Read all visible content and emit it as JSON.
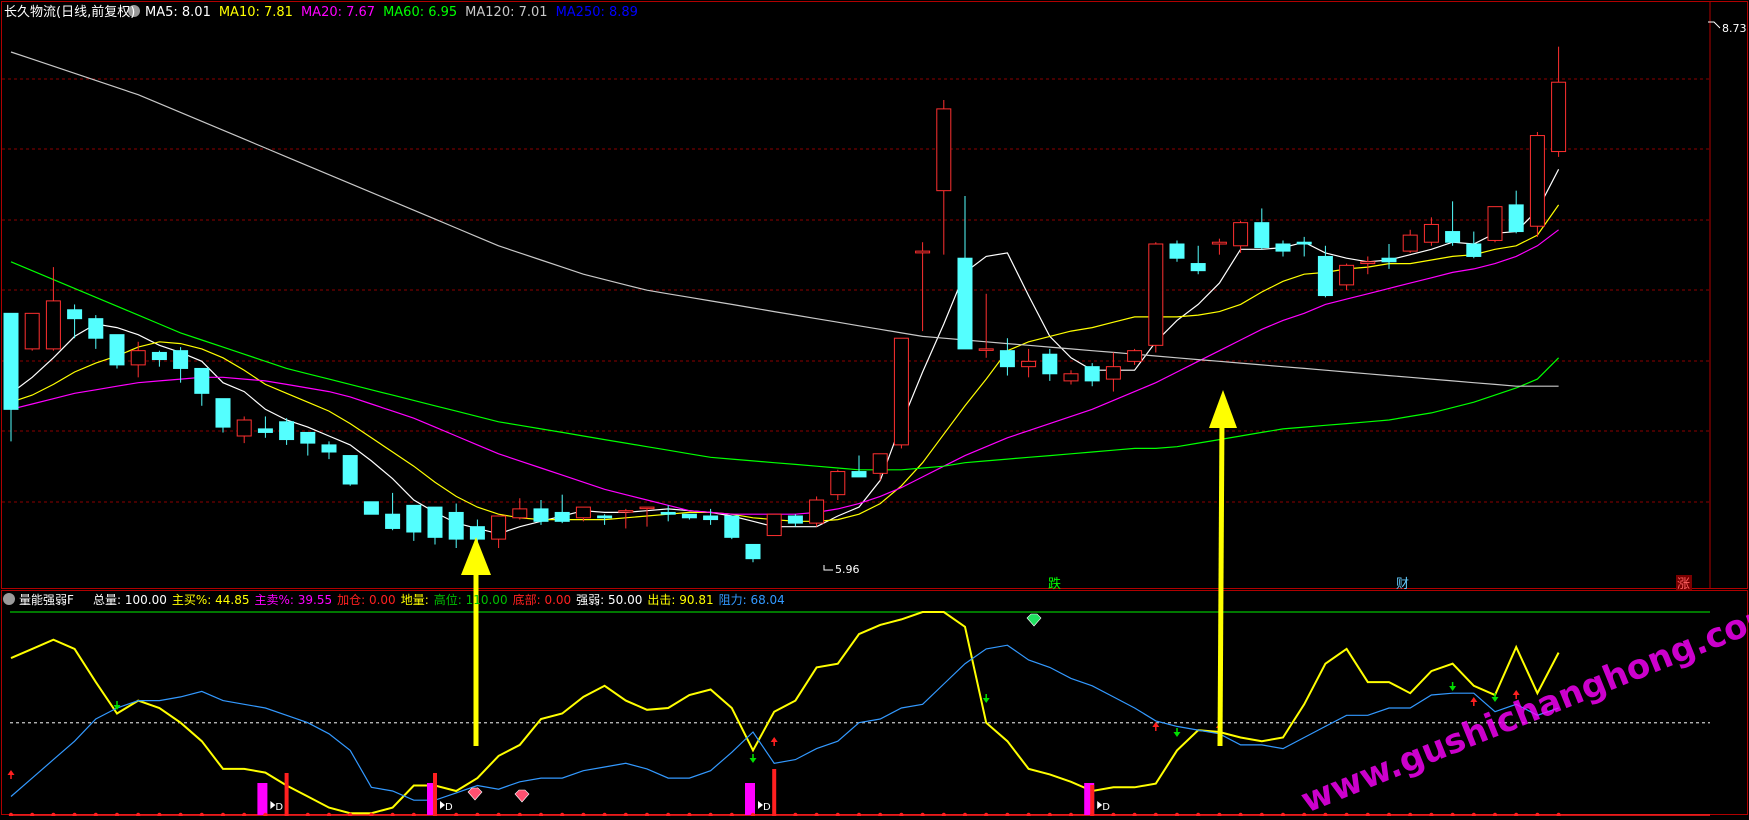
{
  "header": {
    "title": "长久物流(日线,前复权)",
    "ma": [
      {
        "label": "MA5: 8.01",
        "color": "#FFFFFF"
      },
      {
        "label": "MA10: 7.81",
        "color": "#FFFF00"
      },
      {
        "label": "MA20: 7.67",
        "color": "#FF00FF"
      },
      {
        "label": "MA60: 6.95",
        "color": "#00FF00"
      },
      {
        "label": "MA120: 7.01",
        "color": "#C8C8C8"
      },
      {
        "label": "MA250: 8.89",
        "color": "#0000FF"
      }
    ]
  },
  "indicator_header": {
    "name": "量能强弱F",
    "items": [
      {
        "label": "总量: 100.00",
        "color": "#FFFFFF"
      },
      {
        "label": "主买%: 44.85",
        "color": "#FFFF00"
      },
      {
        "label": "主卖%: 39.55",
        "color": "#FF00FF"
      },
      {
        "label": "加仓: 0.00",
        "color": "#FF2020"
      },
      {
        "label": "地量:",
        "color": "#FFFF00"
      },
      {
        "label": "高位: 110.00",
        "color": "#00C000"
      },
      {
        "label": "底部: 0.00",
        "color": "#FF2020"
      },
      {
        "label": "强弱: 50.00",
        "color": "#FFFFFF"
      },
      {
        "label": "出击: 90.81",
        "color": "#FFFF00"
      },
      {
        "label": "阻力: 68.04",
        "color": "#3399FF"
      }
    ]
  },
  "price_labels": {
    "high": "8.73",
    "low": "5.96"
  },
  "event_labels": [
    {
      "text": "跌",
      "color": "#00FF00"
    },
    {
      "text": "财",
      "color": "#66CCFF"
    },
    {
      "text": "涨",
      "color": "#FF4040"
    }
  ],
  "watermark": "www.gushichanghong.com",
  "colors": {
    "up": "#FF3030",
    "down": "#54FFFF",
    "grid": "#8B0000",
    "arrow": "#FFFF00"
  },
  "chart_data": [
    {
      "type": "candlestick",
      "ylim": [
        5.7,
        8.85
      ],
      "candles": [
        [
          7.2,
          6.66,
          7.2,
          6.48
        ],
        [
          7.0,
          7.2,
          7.2,
          6.99
        ],
        [
          7.0,
          7.27,
          7.46,
          6.99
        ],
        [
          7.22,
          7.17,
          7.25,
          7.06
        ],
        [
          7.17,
          7.06,
          7.19,
          7.0
        ],
        [
          7.08,
          6.91,
          7.08,
          6.89
        ],
        [
          6.91,
          6.99,
          7.04,
          6.84
        ],
        [
          6.98,
          6.94,
          6.99,
          6.9
        ],
        [
          6.99,
          6.89,
          7.01,
          6.81
        ],
        [
          6.89,
          6.75,
          6.89,
          6.68
        ],
        [
          6.72,
          6.56,
          6.72,
          6.53
        ],
        [
          6.51,
          6.6,
          6.62,
          6.47
        ],
        [
          6.55,
          6.53,
          6.62,
          6.5
        ],
        [
          6.59,
          6.49,
          6.61,
          6.46
        ],
        [
          6.53,
          6.47,
          6.53,
          6.4
        ],
        [
          6.46,
          6.42,
          6.48,
          6.38
        ],
        [
          6.4,
          6.24,
          6.4,
          6.23
        ],
        [
          6.14,
          6.07,
          6.14,
          6.07
        ],
        [
          6.07,
          5.99,
          6.19,
          5.98
        ],
        [
          6.12,
          5.97,
          6.09,
          5.92
        ],
        [
          6.11,
          5.94,
          6.11,
          5.9
        ],
        [
          6.08,
          5.93,
          6.13,
          5.88
        ],
        [
          6.0,
          5.93,
          6.04,
          5.87
        ],
        [
          5.93,
          6.06,
          6.06,
          5.88
        ],
        [
          6.05,
          6.1,
          6.16,
          6.04
        ],
        [
          6.1,
          6.03,
          6.15,
          6.01
        ],
        [
          6.08,
          6.03,
          6.18,
          6.02
        ],
        [
          6.05,
          6.11,
          6.11,
          6.03
        ],
        [
          6.06,
          6.05,
          6.07,
          6.01
        ],
        [
          6.09,
          6.09,
          6.1,
          5.99
        ],
        [
          6.11,
          6.11,
          6.11,
          6.0
        ],
        [
          6.08,
          6.07,
          6.12,
          6.03
        ],
        [
          6.07,
          6.05,
          6.07,
          6.04
        ],
        [
          6.06,
          6.04,
          6.1,
          6.01
        ],
        [
          6.06,
          5.94,
          6.06,
          5.93
        ],
        [
          5.9,
          5.82,
          5.9,
          5.8
        ],
        [
          5.95,
          6.07,
          6.07,
          5.95
        ],
        [
          6.06,
          6.02,
          6.07,
          6.0
        ],
        [
          6.02,
          6.15,
          6.17,
          6.0
        ],
        [
          6.18,
          6.31,
          6.32,
          6.15
        ],
        [
          6.31,
          6.28,
          6.4,
          6.28
        ],
        [
          6.3,
          6.41,
          6.41,
          6.26
        ],
        [
          6.46,
          7.06,
          7.06,
          6.44
        ],
        [
          7.54,
          7.55,
          7.6,
          7.1
        ],
        [
          7.89,
          8.35,
          8.4,
          7.53
        ],
        [
          7.51,
          7.0,
          7.86,
          7.0
        ],
        [
          7.0,
          7.0,
          7.31,
          6.95
        ],
        [
          6.99,
          6.9,
          7.06,
          6.85
        ],
        [
          6.9,
          6.93,
          7.0,
          6.84
        ],
        [
          6.97,
          6.86,
          7.0,
          6.82
        ],
        [
          6.82,
          6.86,
          6.88,
          6.8
        ],
        [
          6.9,
          6.82,
          6.92,
          6.79
        ],
        [
          6.83,
          6.9,
          6.98,
          6.76
        ],
        [
          6.93,
          6.99,
          7.0,
          6.91
        ],
        [
          7.02,
          7.59,
          7.6,
          6.98
        ],
        [
          7.59,
          7.51,
          7.61,
          7.49
        ],
        [
          7.48,
          7.44,
          7.58,
          7.42
        ],
        [
          7.59,
          7.6,
          7.62,
          7.53
        ],
        [
          7.58,
          7.71,
          7.72,
          7.54
        ],
        [
          7.71,
          7.57,
          7.79,
          7.56
        ],
        [
          7.59,
          7.55,
          7.61,
          7.52
        ],
        [
          7.6,
          7.59,
          7.63,
          7.52
        ],
        [
          7.52,
          7.3,
          7.58,
          7.29
        ],
        [
          7.36,
          7.47,
          7.48,
          7.33
        ],
        [
          7.48,
          7.49,
          7.52,
          7.42
        ],
        [
          7.51,
          7.49,
          7.59,
          7.45
        ],
        [
          7.55,
          7.64,
          7.67,
          7.54
        ],
        [
          7.6,
          7.7,
          7.74,
          7.58
        ],
        [
          7.66,
          7.6,
          7.83,
          7.58
        ],
        [
          7.59,
          7.52,
          7.66,
          7.51
        ],
        [
          7.61,
          7.8,
          7.8,
          7.6
        ],
        [
          7.81,
          7.66,
          7.89,
          7.65
        ],
        [
          7.69,
          8.2,
          8.22,
          7.63
        ],
        [
          8.11,
          8.5,
          8.7,
          8.08
        ]
      ],
      "ma": [
        {
          "name": "MA5",
          "color": "#FFFFFF",
          "values": [
            6.75,
            6.84,
            6.95,
            7.07,
            7.14,
            7.12,
            7.08,
            7.02,
            6.98,
            6.93,
            6.81,
            6.76,
            6.66,
            6.6,
            6.56,
            6.51,
            6.46,
            6.37,
            6.27,
            6.15,
            6.08,
            6.02,
            5.99,
            5.96,
            6.0,
            6.03,
            6.06,
            6.09,
            6.08,
            6.08,
            6.09,
            6.1,
            6.09,
            6.08,
            6.06,
            6.03,
            6.0,
            6.0,
            6.0,
            6.06,
            6.11,
            6.26,
            6.58,
            6.87,
            7.14,
            7.43,
            7.52,
            7.54,
            7.3,
            7.07,
            6.95,
            6.88,
            6.88,
            6.88,
            7.04,
            7.16,
            7.25,
            7.37,
            7.56,
            7.56,
            7.57,
            7.6,
            7.54,
            7.51,
            7.49,
            7.5,
            7.53,
            7.56,
            7.6,
            7.59,
            7.65,
            7.66,
            7.78,
            8.01
          ]
        },
        {
          "name": "MA10",
          "color": "#FFFF00",
          "values": [
            6.7,
            6.74,
            6.8,
            6.87,
            6.92,
            6.96,
            7.01,
            7.04,
            7.03,
            7.0,
            6.95,
            6.88,
            6.8,
            6.75,
            6.7,
            6.65,
            6.58,
            6.5,
            6.42,
            6.34,
            6.25,
            6.17,
            6.11,
            6.07,
            6.05,
            6.04,
            6.04,
            6.04,
            6.04,
            6.05,
            6.06,
            6.07,
            6.08,
            6.08,
            6.07,
            6.05,
            6.04,
            6.03,
            6.03,
            6.04,
            6.07,
            6.13,
            6.23,
            6.36,
            6.52,
            6.68,
            6.83,
            6.99,
            7.04,
            7.07,
            7.1,
            7.12,
            7.15,
            7.18,
            7.18,
            7.18,
            7.19,
            7.21,
            7.25,
            7.32,
            7.38,
            7.42,
            7.43,
            7.45,
            7.46,
            7.48,
            7.48,
            7.5,
            7.52,
            7.53,
            7.56,
            7.58,
            7.64,
            7.81
          ]
        },
        {
          "name": "MA20",
          "color": "#FF00FF",
          "values": [
            6.66,
            6.69,
            6.72,
            6.75,
            6.77,
            6.79,
            6.81,
            6.82,
            6.83,
            6.84,
            6.84,
            6.83,
            6.82,
            6.8,
            6.78,
            6.76,
            6.73,
            6.69,
            6.65,
            6.61,
            6.56,
            6.51,
            6.46,
            6.41,
            6.37,
            6.33,
            6.29,
            6.25,
            6.21,
            6.18,
            6.15,
            6.12,
            6.09,
            6.08,
            6.07,
            6.07,
            6.07,
            6.07,
            6.08,
            6.1,
            6.13,
            6.17,
            6.22,
            6.28,
            6.34,
            6.4,
            6.45,
            6.5,
            6.54,
            6.58,
            6.62,
            6.66,
            6.71,
            6.76,
            6.81,
            6.87,
            6.93,
            6.99,
            7.05,
            7.11,
            7.16,
            7.2,
            7.25,
            7.28,
            7.31,
            7.34,
            7.37,
            7.4,
            7.43,
            7.45,
            7.48,
            7.52,
            7.58,
            7.67
          ]
        },
        {
          "name": "MA60",
          "color": "#00FF00",
          "values": [
            7.49,
            7.44,
            7.39,
            7.34,
            7.29,
            7.24,
            7.19,
            7.14,
            7.09,
            7.05,
            7.01,
            6.97,
            6.93,
            6.89,
            6.86,
            6.83,
            6.8,
            6.77,
            6.74,
            6.71,
            6.68,
            6.65,
            6.62,
            6.59,
            6.57,
            6.55,
            6.53,
            6.51,
            6.49,
            6.47,
            6.45,
            6.43,
            6.41,
            6.39,
            6.38,
            6.37,
            6.36,
            6.35,
            6.34,
            6.33,
            6.32,
            6.32,
            6.32,
            6.33,
            6.34,
            6.36,
            6.37,
            6.38,
            6.39,
            6.4,
            6.41,
            6.42,
            6.43,
            6.44,
            6.44,
            6.45,
            6.47,
            6.49,
            6.51,
            6.53,
            6.55,
            6.56,
            6.57,
            6.58,
            6.59,
            6.6,
            6.62,
            6.64,
            6.67,
            6.7,
            6.74,
            6.78,
            6.83,
            6.95
          ]
        },
        {
          "name": "MA120",
          "color": "#C8C8C8",
          "values": [
            8.67,
            8.63,
            8.59,
            8.55,
            8.51,
            8.47,
            8.43,
            8.38,
            8.33,
            8.28,
            8.23,
            8.18,
            8.13,
            8.08,
            8.03,
            7.98,
            7.93,
            7.88,
            7.83,
            7.78,
            7.73,
            7.68,
            7.63,
            7.58,
            7.54,
            7.5,
            7.46,
            7.42,
            7.39,
            7.36,
            7.33,
            7.31,
            7.29,
            7.27,
            7.25,
            7.23,
            7.21,
            7.19,
            7.17,
            7.15,
            7.13,
            7.11,
            7.09,
            7.07,
            7.06,
            7.05,
            7.04,
            7.03,
            7.02,
            7.01,
            7.0,
            6.99,
            6.98,
            6.97,
            6.96,
            6.95,
            6.94,
            6.93,
            6.92,
            6.91,
            6.9,
            6.89,
            6.88,
            6.87,
            6.86,
            6.85,
            6.84,
            6.83,
            6.82,
            6.81,
            6.8,
            6.79,
            6.79,
            6.79
          ]
        }
      ]
    },
    {
      "type": "line",
      "ylim": [
        0,
        110
      ],
      "series": [
        {
          "name": "出击",
          "color": "#FFFF00",
          "values": [
            85,
            90,
            95,
            90,
            72,
            55,
            62,
            58,
            50,
            40,
            25,
            25,
            23,
            16,
            10,
            4,
            1,
            1,
            4,
            16,
            16,
            13,
            20,
            32,
            38,
            52,
            55,
            64,
            70,
            62,
            57,
            58,
            65,
            68,
            58,
            35,
            56,
            62,
            80,
            82,
            98,
            103,
            106,
            110,
            110,
            102,
            50,
            40,
            25,
            22,
            18,
            13,
            15,
            15,
            17,
            35,
            46,
            45,
            42,
            40,
            42,
            60,
            82,
            90,
            72,
            72,
            66,
            78,
            82,
            70,
            65,
            91,
            66,
            88
          ]
        },
        {
          "name": "阻力",
          "color": "#3399FF",
          "values": [
            10,
            20,
            30,
            40,
            52,
            58,
            62,
            62,
            64,
            67,
            62,
            60,
            58,
            54,
            50,
            44,
            35,
            15,
            13,
            8,
            8,
            12,
            16,
            14,
            18,
            20,
            20,
            24,
            26,
            28,
            25,
            20,
            20,
            24,
            34,
            45,
            28,
            30,
            36,
            40,
            50,
            52,
            58,
            60,
            71,
            82,
            90,
            92,
            84,
            80,
            74,
            70,
            64,
            58,
            51,
            48,
            46,
            44,
            38,
            38,
            36,
            42,
            48,
            54,
            54,
            58,
            58,
            65,
            66,
            66,
            56,
            60,
            54,
            58
          ]
        }
      ]
    }
  ]
}
